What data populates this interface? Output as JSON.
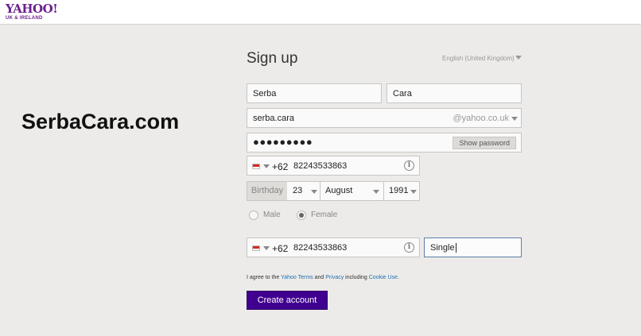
{
  "header": {
    "logo_main": "YAHOO!",
    "logo_sub": "UK & IRELAND"
  },
  "watermark": "SerbaCara.com",
  "form": {
    "title": "Sign up",
    "language": "English (United Kingdom)",
    "first_name": "Serba",
    "last_name": "Cara",
    "username": "serba.cara",
    "domain": "@yahoo.co.uk",
    "password_dots": "●●●●●●●●●",
    "show_password_label": "Show password",
    "phone": {
      "country_code": "+62",
      "number": "82243533863"
    },
    "birthday": {
      "label": "Birthday",
      "day": "23",
      "month": "August",
      "year": "1991"
    },
    "gender": {
      "male": "Male",
      "female": "Female",
      "selected": "female"
    },
    "recovery_phone": {
      "country_code": "+62",
      "number": "82243533863"
    },
    "relationship": "Single",
    "agree": {
      "prefix": "I agree to the ",
      "terms_link": "Yahoo Terms",
      "and": " and ",
      "privacy_link": "Privacy",
      "including": " including ",
      "cookie_link": "Cookie Use",
      "suffix": "."
    },
    "create_button": "Create account"
  },
  "colors": {
    "brand_purple": "#400090",
    "link_blue": "#1f6fb2",
    "page_background": "#ecebe9"
  }
}
